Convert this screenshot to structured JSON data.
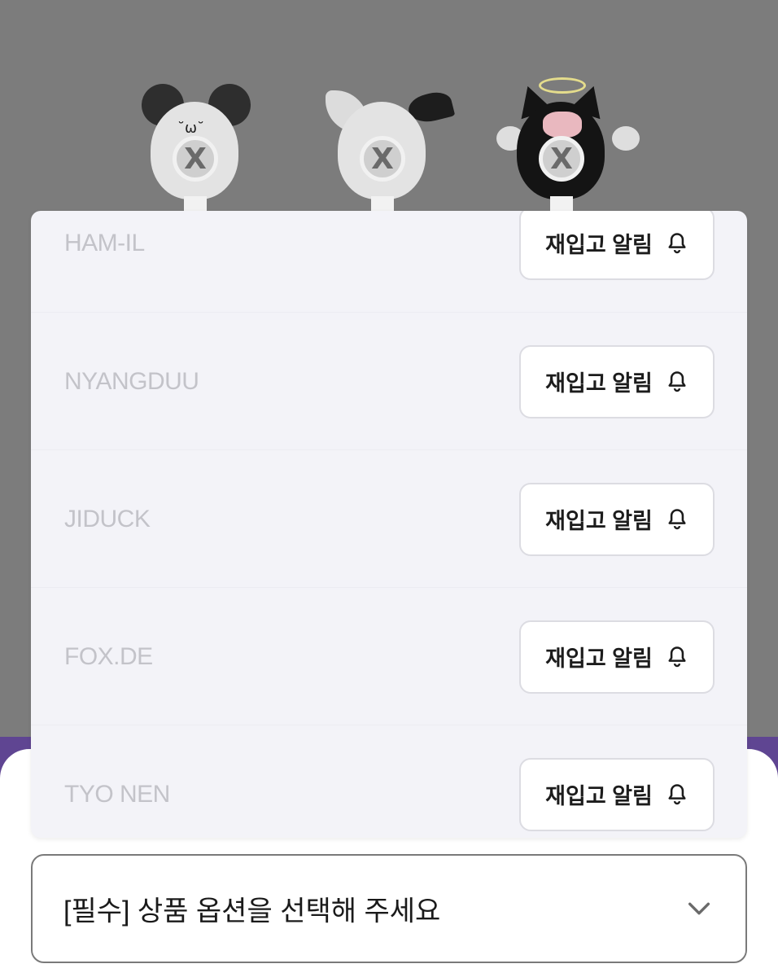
{
  "options": [
    {
      "name": "HAM-IL",
      "button_label": "재입고 알림",
      "icon": "bell-icon"
    },
    {
      "name": "NYANGDUU",
      "button_label": "재입고 알림",
      "icon": "bell-icon"
    },
    {
      "name": "JIDUCK",
      "button_label": "재입고 알림",
      "icon": "bell-icon"
    },
    {
      "name": "FOX.DE",
      "button_label": "재입고 알림",
      "icon": "bell-icon"
    },
    {
      "name": "TYO NEN",
      "button_label": "재입고 알림",
      "icon": "bell-icon"
    }
  ],
  "select": {
    "label": "[필수] 상품 옵션을 선택해 주세요",
    "icon": "chevron-down-icon"
  },
  "colors": {
    "overlay": "#7c7c7c",
    "accent": "#5f4592",
    "panel": "#f3f3f8",
    "option_text": "#c3c3c9"
  }
}
